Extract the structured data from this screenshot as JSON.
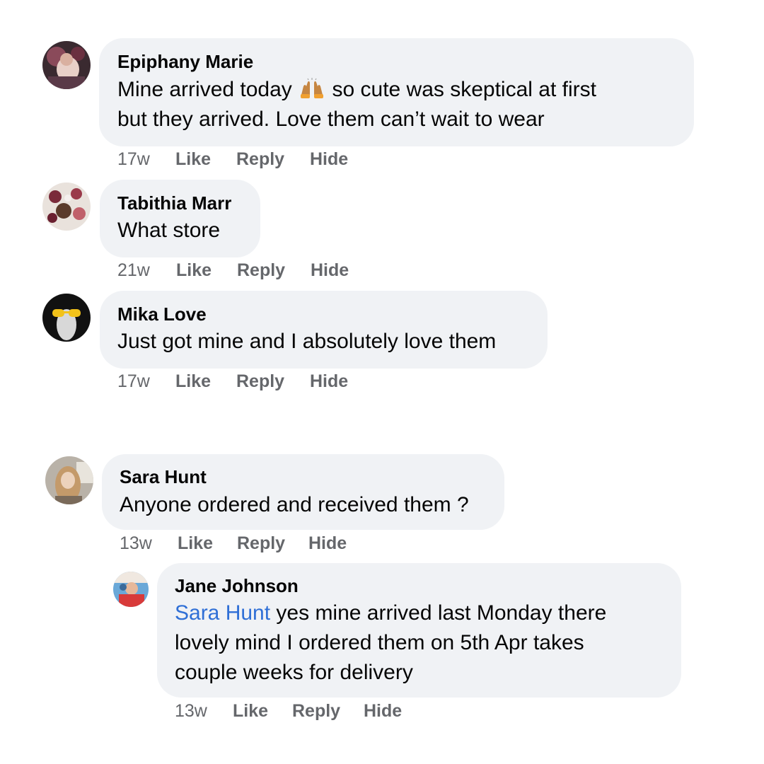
{
  "comments": [
    {
      "author": "Epiphany Marie",
      "line1_before_emoji": "Mine arrived today",
      "emoji": "raising-hands-emoji",
      "line1_after_emoji": "so cute was skeptical at first",
      "line2": "but they arrived. Love them can’t wait to wear",
      "time": "17w",
      "like": "Like",
      "reply": "Reply",
      "hide": "Hide"
    },
    {
      "author": "Tabithia Marr",
      "line1": "What store",
      "time": "21w",
      "like": "Like",
      "reply": "Reply",
      "hide": "Hide"
    },
    {
      "author": "Mika Love",
      "line1": "Just got mine and I absolutely love them",
      "time": "17w",
      "like": "Like",
      "reply": "Reply",
      "hide": "Hide"
    },
    {
      "author": "Sara Hunt",
      "line1": "Anyone ordered and received them ?",
      "time": "13w",
      "like": "Like",
      "reply": "Reply",
      "hide": "Hide"
    },
    {
      "author": "Jane Johnson",
      "mention": "Sara Hunt",
      "line1": "yes mine arrived last Monday there",
      "line2": "lovely mind I ordered them on 5th Apr takes",
      "line3": "couple weeks for delivery",
      "time": "13w",
      "like": "Like",
      "reply": "Reply",
      "hide": "Hide"
    }
  ],
  "colors": {
    "bubble": "#f0f2f5",
    "meta_text": "#65676b",
    "mention": "#2f6fd6"
  }
}
